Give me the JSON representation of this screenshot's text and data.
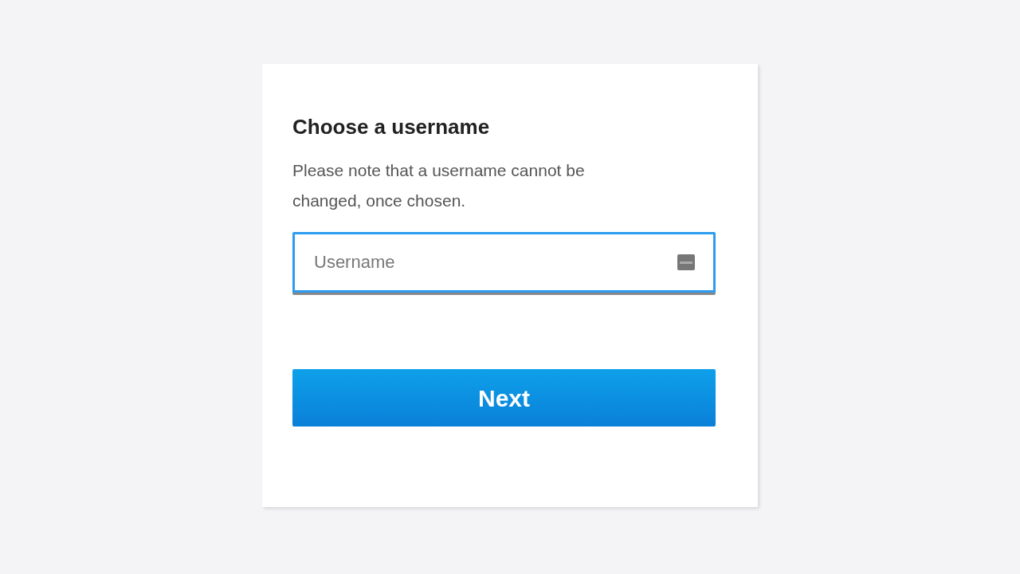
{
  "card": {
    "title": "Choose a username",
    "note": "Please note that a username cannot be changed, once chosen."
  },
  "username_field": {
    "placeholder": "Username",
    "focused": true
  },
  "buttons": [
    {
      "label": "Next"
    }
  ]
}
